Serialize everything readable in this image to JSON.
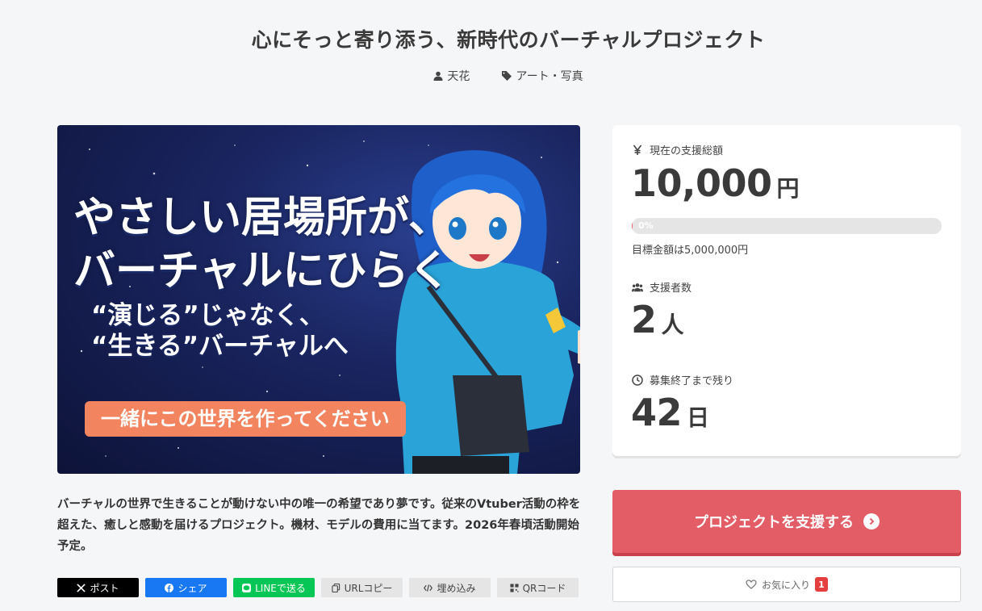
{
  "title": "心にそっと寄り添う、新時代のバーチャルプロジェクト",
  "meta": {
    "author": "天花",
    "category": "アート・写真"
  },
  "hero": {
    "line1": "やさしい居場所が、",
    "line2": "バーチャルにひらく",
    "sub1": "“演じる”じゃなく、",
    "sub2": "“生きる”バーチャルへ",
    "button": "一緒にこの世界を作ってください"
  },
  "description": "バーチャルの世界で生きることが動けない中の唯一の希望であり夢です。従来のVtuber活動の枠を超えた、癒しと感動を届けるプロジェクト。機材、モデルの費用に当てます。2026年春頃活動開始予定。",
  "share": {
    "x": "ポスト",
    "facebook": "シェア",
    "line": "LINEで送る",
    "url": "URLコピー",
    "embed": "埋め込み",
    "qr": "QRコード"
  },
  "stats": {
    "total_label": "現在の支援総額",
    "total_value": "10,000",
    "total_unit": "円",
    "progress_text": "0%",
    "progress_fraction": 0.002,
    "goal": "目標金額は5,000,000円",
    "supporters_label": "支援者数",
    "supporters_value": "2",
    "supporters_unit": "人",
    "remaining_label": "募集終了まで残り",
    "remaining_value": "42",
    "remaining_unit": "日"
  },
  "actions": {
    "support": "プロジェクトを支援する",
    "favorite": "お気に入り",
    "favorite_count": "1"
  },
  "colors": {
    "accent": "#e35d67",
    "x": "#000000",
    "facebook": "#1877f2",
    "line": "#06c755"
  }
}
